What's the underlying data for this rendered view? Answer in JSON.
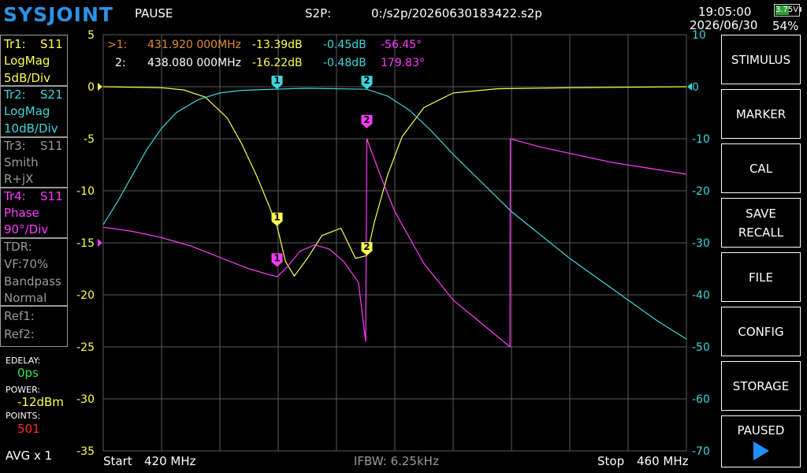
{
  "header": {
    "logo": "SYSJOINT",
    "status": "PAUSE",
    "mode_label": "S2P:",
    "file_path": "0:/s2p/20260630183422.s2p",
    "time": "19:05:00",
    "date": "2026/06/30",
    "battery_voltage": "3.75V",
    "battery_percent": "54%",
    "battery_level": 0.54
  },
  "traces": [
    {
      "name": "Tr1:",
      "param": "S11",
      "format": "LogMag",
      "scale": "5dB/Div",
      "color": "#ffff4d"
    },
    {
      "name": "Tr2:",
      "param": "S21",
      "format": "LogMag",
      "scale": "10dB/Div",
      "color": "#3dd6dc"
    },
    {
      "name": "Tr3:",
      "param": "S11",
      "format": "Smith",
      "scale": "R+jX",
      "color": "#9a9a9a"
    },
    {
      "name": "Tr4:",
      "param": "S11",
      "format": "Phase",
      "scale": "90°/Div",
      "color": "#ff3cff"
    }
  ],
  "tdr": {
    "label": "TDR:",
    "vf": "VF:70%",
    "mode": "Bandpass",
    "window": "Normal"
  },
  "refs": [
    "Ref1:",
    "Ref2:"
  ],
  "settings": {
    "edelay_label": "EDELAY:",
    "edelay_value": "0ps",
    "power_label": "POWER:",
    "power_value": "-12dBm",
    "points_label": "POINTS:",
    "points_value": "501",
    "avg": "AVG x 1"
  },
  "markers": [
    {
      "id": ">1:",
      "freq": "431.920 000MHz",
      "s11": "-13.39dB",
      "s21": "-0.45dB",
      "phase": "-56.45°"
    },
    {
      "id": "2:",
      "freq": "438.080 000MHz",
      "s11": "-16.22dB",
      "s21": "-0.48dB",
      "phase": "179.83°"
    }
  ],
  "footer": {
    "start_label": "Start",
    "start_value": "420 MHz",
    "ifbw": "IFBW: 6.25kHz",
    "stop_label": "Stop",
    "stop_value": "460 MHz"
  },
  "menu": [
    "STIMULUS",
    "MARKER",
    "CAL",
    "SAVE\nRECALL",
    "FILE",
    "CONFIG",
    "STORAGE",
    "PAUSED"
  ],
  "chart_data": {
    "type": "line",
    "x_range": [
      420,
      460
    ],
    "left_axis": {
      "ticks": [
        "5",
        "0",
        "-5",
        "-10",
        "-15",
        "-20",
        "-25",
        "-30",
        "-35"
      ],
      "range": [
        -35,
        5
      ]
    },
    "right_axis": {
      "ticks": [
        "10",
        "0",
        "-10",
        "-20",
        "-30",
        "-40",
        "-50",
        "-60",
        "-70"
      ],
      "range": [
        -70,
        10
      ]
    },
    "grid": true,
    "series": [
      {
        "name": "S11",
        "axis": "left",
        "color": "#ffff4d",
        "x": [
          420,
          424,
          425.5,
          427,
          428.5,
          429.5,
          430.5,
          431.3,
          431.92,
          432.5,
          433.1,
          434,
          435,
          436.3,
          437.3,
          438.08,
          438.6,
          439.5,
          440.5,
          442,
          444,
          447,
          452,
          460
        ],
        "y": [
          0,
          -0.1,
          -0.3,
          -1.0,
          -3.0,
          -5.5,
          -8.5,
          -11.2,
          -13.39,
          -16.8,
          -18.2,
          -16.5,
          -14.3,
          -13.6,
          -16.5,
          -16.22,
          -13.0,
          -8.5,
          -4.8,
          -2.0,
          -0.6,
          -0.2,
          -0.1,
          0
        ]
      },
      {
        "name": "S21",
        "axis": "right",
        "color": "#3dd6dc",
        "x": [
          420,
          421,
          422,
          423,
          424,
          425,
          426.5,
          428,
          429.5,
          431.92,
          434,
          438.08,
          439.5,
          441,
          442.5,
          444,
          446,
          448,
          450,
          452,
          454,
          456,
          458,
          460
        ],
        "y": [
          -26.5,
          -22,
          -17,
          -12,
          -8,
          -5,
          -2.5,
          -1.2,
          -0.7,
          -0.45,
          -0.3,
          -0.48,
          -1.8,
          -4.5,
          -8.5,
          -13,
          -18.5,
          -24,
          -28.5,
          -33,
          -37,
          -41,
          -45,
          -48.5
        ]
      },
      {
        "name": "S11 Phase",
        "axis": "left",
        "color": "#ff3cff",
        "scale_note": "degrees mapped 90°/Div",
        "x": [
          420,
          422,
          424,
          426,
          428,
          430,
          431.5,
          431.92,
          432.5,
          433.5,
          434.5,
          435.5,
          436.5,
          437.5,
          438.0,
          438.08,
          439,
          440,
          442,
          444,
          446,
          447.9,
          447.92,
          450,
          455,
          460
        ],
        "y": [
          -13.5,
          -13.9,
          -14.5,
          -15.3,
          -16.4,
          -17.5,
          -18.1,
          -18.25,
          -17.5,
          -15.8,
          -15.2,
          -15.6,
          -16.8,
          -18.8,
          -24.5,
          -5.0,
          -8.5,
          -12.0,
          -17.0,
          -20.5,
          -22.8,
          -25.0,
          -5.0,
          -5.8,
          -7.3,
          -8.4
        ]
      }
    ],
    "markers": [
      {
        "label": "1",
        "series": "S21",
        "x": 431.92,
        "y": -0.45
      },
      {
        "label": "2",
        "series": "S21",
        "x": 438.08,
        "y": -0.48
      },
      {
        "label": "1",
        "series": "S11",
        "x": 431.92,
        "y": -13.39
      },
      {
        "label": "2",
        "series": "S11",
        "x": 438.08,
        "y": -16.22
      },
      {
        "label": "1",
        "series": "S11 Phase",
        "x": 431.92,
        "y": -17.3
      },
      {
        "label": "2",
        "series": "S11 Phase",
        "x": 438.08,
        "y": -4.0
      }
    ]
  }
}
